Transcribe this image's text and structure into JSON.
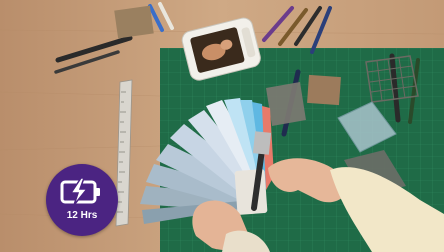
{
  "badge": {
    "label": "12 Hrs",
    "icon": "battery-charging-icon",
    "color": "#4b2482"
  },
  "colors": {
    "table": "#c9a27e",
    "mat": "#1f6b47",
    "monitor": "#f2f0ea"
  }
}
